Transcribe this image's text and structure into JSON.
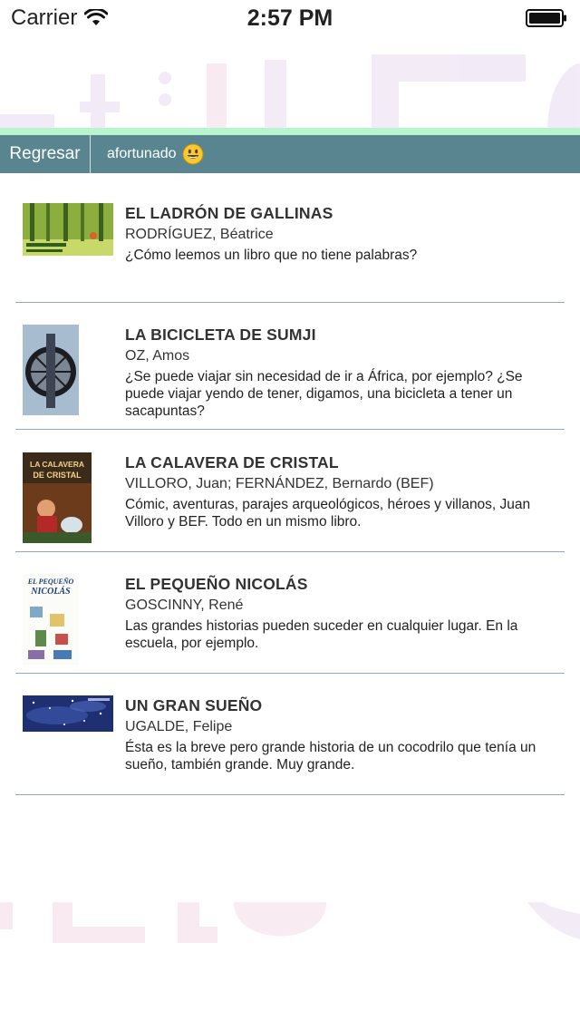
{
  "status_bar": {
    "carrier": "Carrier",
    "time": "2:57 PM"
  },
  "nav": {
    "back_label": "Regresar",
    "title": "afortunado"
  },
  "books": [
    {
      "title": "EL LADRÓN DE GALLINAS",
      "author": "RODRÍGUEZ, Béatrice",
      "description": "¿Cómo leemos un libro que no tiene palabras?"
    },
    {
      "title": "LA BICICLETA DE SUMJI",
      "author": "OZ, Amos",
      "description": "¿Se puede viajar sin necesidad de ir a África, por ejemplo? ¿Se puede viajar yendo de tener, digamos, una bicicleta a tener un sacapuntas?"
    },
    {
      "title": "LA CALAVERA DE CRISTAL",
      "author": "VILLORO, Juan; FERNÁNDEZ, Bernardo (BEF)",
      "description": "Cómic, aventuras, parajes arqueológicos, héroes y villanos, Juan Villoro y BEF. Todo en un mismo libro.",
      "cover_text": "LA CALAVERA DE CRISTAL"
    },
    {
      "title": "EL PEQUEÑO NICOLÁS",
      "author": "GOSCINNY, René",
      "description": "Las grandes historias pueden suceder en cualquier lugar. En la escuela, por ejemplo.",
      "cover_text": "EL PEQUEÑO NICOLÁS"
    },
    {
      "title": "UN GRAN SUEÑO",
      "author": "UGALDE, Felipe",
      "description": "Ésta es la breve pero grande historia de un cocodrilo que tenía un sueño, también grande. Muy grande."
    }
  ],
  "colors": {
    "nav_background": "#58858f",
    "accent_line": "#b8f5cf",
    "divider": "#8faab4"
  }
}
